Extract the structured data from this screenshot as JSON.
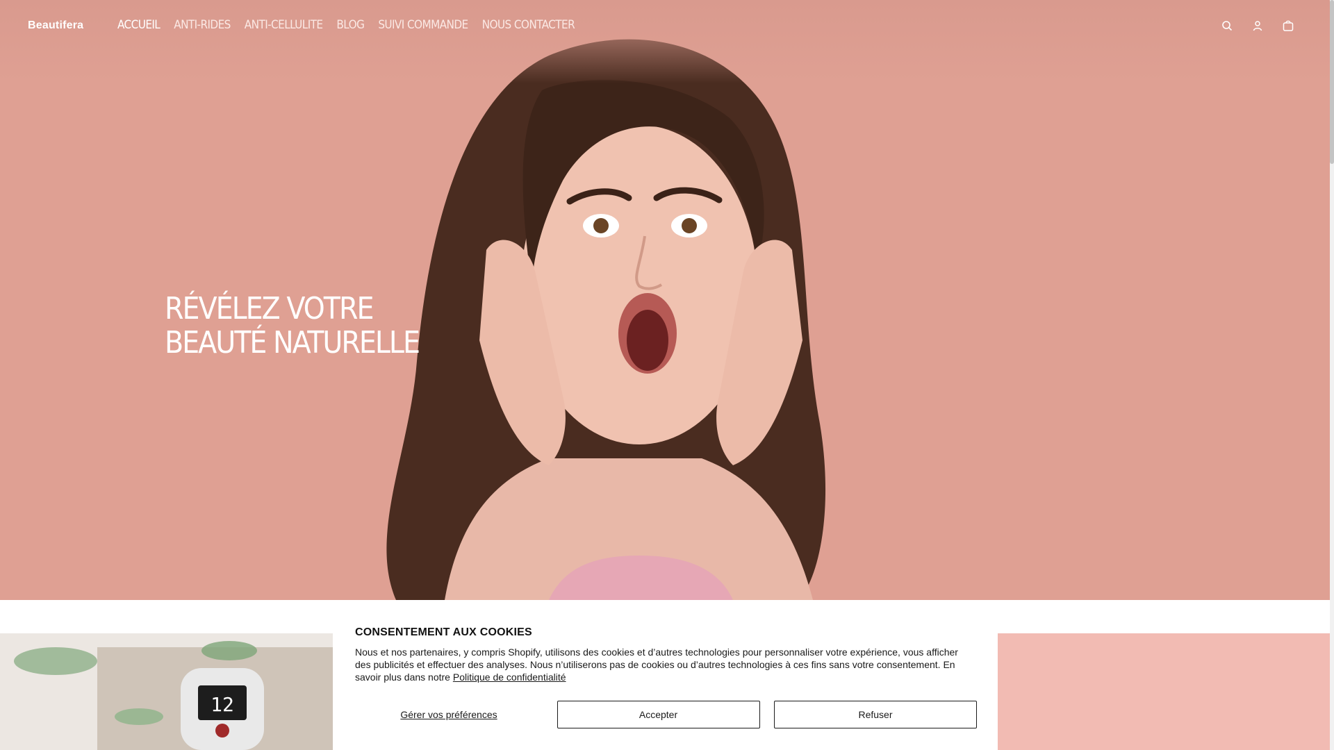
{
  "brand": {
    "name": "Beautifera"
  },
  "nav": {
    "items": [
      {
        "label": "ACCUEIL"
      },
      {
        "label": "ANTI-RIDES"
      },
      {
        "label": "ANTI-CELLULITE"
      },
      {
        "label": "BLOG"
      },
      {
        "label": "SUIVI COMMANDE"
      },
      {
        "label": "NOUS CONTACTER"
      }
    ],
    "active": "ACCUEIL",
    "icons": [
      "search-icon",
      "account-icon",
      "cart-icon"
    ]
  },
  "hero": {
    "headline_line1": "RÉVÉLEZ VOTRE",
    "headline_line2": "BEAUTÉ NATURELLE",
    "background_color": "#dfa093"
  },
  "product_preview": {
    "display_value": "12"
  },
  "cookie_banner": {
    "title": "CONSENTEMENT AUX COOKIES",
    "text": "Nous et nos partenaires, y compris Shopify, utilisons des cookies et d’autres technologies pour personnaliser votre expérience, vous afficher des publicités et effectuer des analyses. Nous n’utiliserons pas de cookies ou d’autres technologies à ces fins sans votre consentement. En savoir plus dans notre",
    "privacy_link": "Politique de confidentialité",
    "manage_label": "Gérer vos préférences",
    "accept_label": "Accepter",
    "decline_label": "Refuser"
  }
}
